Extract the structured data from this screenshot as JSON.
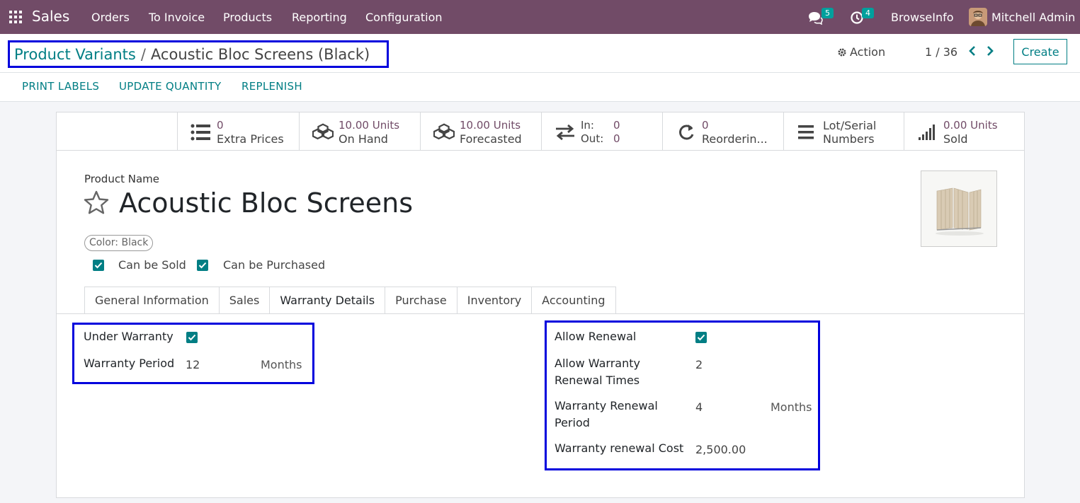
{
  "nav": {
    "app_name": "Sales",
    "menu": [
      "Orders",
      "To Invoice",
      "Products",
      "Reporting",
      "Configuration"
    ],
    "messages_count": "5",
    "activities_count": "4",
    "company": "BrowseInfo",
    "user": "Mitchell Admin"
  },
  "control": {
    "breadcrumb_parent": "Product Variants",
    "breadcrumb_sep": "/",
    "breadcrumb_current": "Acoustic Bloc Screens (Black)",
    "action_label": "Action",
    "pager": "1 / 36",
    "create_label": "Create",
    "status_buttons": [
      "PRINT LABELS",
      "UPDATE QUANTITY",
      "REPLENISH"
    ]
  },
  "stats": [
    {
      "line1": "0",
      "line2": "Extra Prices",
      "icon": "list-icon"
    },
    {
      "line1": "10.00 Units",
      "line2": "On Hand",
      "icon": "cubes-icon"
    },
    {
      "line1": "10.00 Units",
      "line2": "Forecasted",
      "icon": "cubes-icon"
    },
    {
      "line1": "In:",
      "line1b": "0",
      "line2": "Out:",
      "line2b": "0",
      "icon": "exchange-icon"
    },
    {
      "line1": "0",
      "line2": "Reorderin...",
      "icon": "refresh-icon"
    },
    {
      "line1": "Lot/Serial",
      "line2": "Numbers",
      "icon": "bars-icon"
    },
    {
      "line1": "0.00 Units",
      "line2": "Sold",
      "icon": "signal-icon"
    }
  ],
  "product": {
    "name_label": "Product Name",
    "name": "Acoustic Bloc Screens",
    "tag": "Color: Black",
    "can_be_sold": "Can be Sold",
    "can_be_purchased": "Can be Purchased"
  },
  "tabs": [
    "General Information",
    "Sales",
    "Warranty Details",
    "Purchase",
    "Inventory",
    "Accounting"
  ],
  "warranty": {
    "under_warranty_label": "Under Warranty",
    "period_label": "Warranty Period",
    "period_value": "12",
    "period_unit": "Months",
    "allow_renewal_label": "Allow Renewal",
    "renewal_times_label_1": "Allow Warranty",
    "renewal_times_label_2": "Renewal Times",
    "renewal_times_value": "2",
    "renewal_period_label_1": "Warranty Renewal",
    "renewal_period_label_2": "Period",
    "renewal_period_value": "4",
    "renewal_period_unit": "Months",
    "renewal_cost_label": "Warranty renewal Cost",
    "renewal_cost_value": "2,500.00"
  }
}
